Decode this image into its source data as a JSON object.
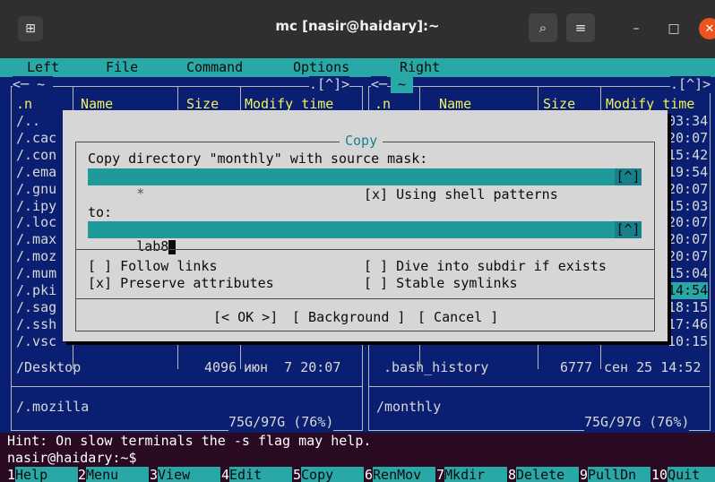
{
  "window": {
    "title": "mc [nasir@haidary]:~",
    "new_tab_icon": "⊞",
    "search_icon": "⌕",
    "menu_icon": "≡",
    "minimize_icon": "–",
    "maximize_icon": "□",
    "close_icon": "✕"
  },
  "menubar": [
    "Left",
    "File",
    "Command",
    "Options",
    "Right"
  ],
  "left_panel": {
    "top_left": "<─ ~ ",
    "top_right": ".[^]>",
    "headers": [
      ".n",
      "Name",
      "Size",
      "Modify time"
    ],
    "entries": [
      "/..",
      "/.cac",
      "/.con",
      "/.ema",
      "/.gnu",
      "/.ipy",
      "/.loc",
      "/.max",
      "/.moz",
      "/.mum",
      "/.pki",
      "/.sag",
      "/.ssh",
      "/.vsc"
    ],
    "last_row": {
      "name": "/Desktop",
      "size": "4096",
      "date": "июн  7 20:07"
    },
    "info": "/.mozilla",
    "usage": "75G/97G (76%)"
  },
  "right_panel": {
    "top_left": "<─",
    "path": "~",
    "top_right": ".[^]>",
    "headers": [
      ".n",
      "Name",
      "Size",
      "Modify time"
    ],
    "times": [
      "03:34",
      "20:07",
      "15:42",
      "19:54",
      "20:07",
      "15:03",
      "20:07",
      "20:07",
      "20:07",
      "15:04",
      "14:54",
      "18:15",
      "17:46",
      "10:15"
    ],
    "last_row": {
      "name": ".bash_history",
      "size": "6777",
      "date": "сен 25 14:52"
    },
    "info": "/monthly",
    "usage": "75G/97G (76%)"
  },
  "dialog": {
    "title": "Copy",
    "source_label": "Copy directory \"monthly\" with source mask:",
    "source_value": "*",
    "history_button": "[^]",
    "shell_patterns": "[x] Using shell patterns",
    "to_label": "to:",
    "to_value": "lab8",
    "follow_links": "[ ] Follow links",
    "preserve_attributes": "[x] Preserve attributes",
    "dive_into": "[ ] Dive into subdir if exists",
    "stable_symlinks": "[ ] Stable symlinks",
    "ok_button": "[< OK >]",
    "background_button": "[ Background ]",
    "cancel_button": "[ Cancel ]"
  },
  "hint": "Hint: On slow terminals the -s flag may help.",
  "prompt": "nasir@haidary:~$",
  "function_keys": [
    {
      "num": "1",
      "label": "Help"
    },
    {
      "num": "2",
      "label": "Menu"
    },
    {
      "num": "3",
      "label": "View"
    },
    {
      "num": "4",
      "label": "Edit"
    },
    {
      "num": "5",
      "label": "Copy"
    },
    {
      "num": "6",
      "label": "RenMov"
    },
    {
      "num": "7",
      "label": "Mkdir"
    },
    {
      "num": "8",
      "label": "Delete"
    },
    {
      "num": "9",
      "label": "PullDn"
    },
    {
      "num": "10",
      "label": "Quit"
    }
  ]
}
